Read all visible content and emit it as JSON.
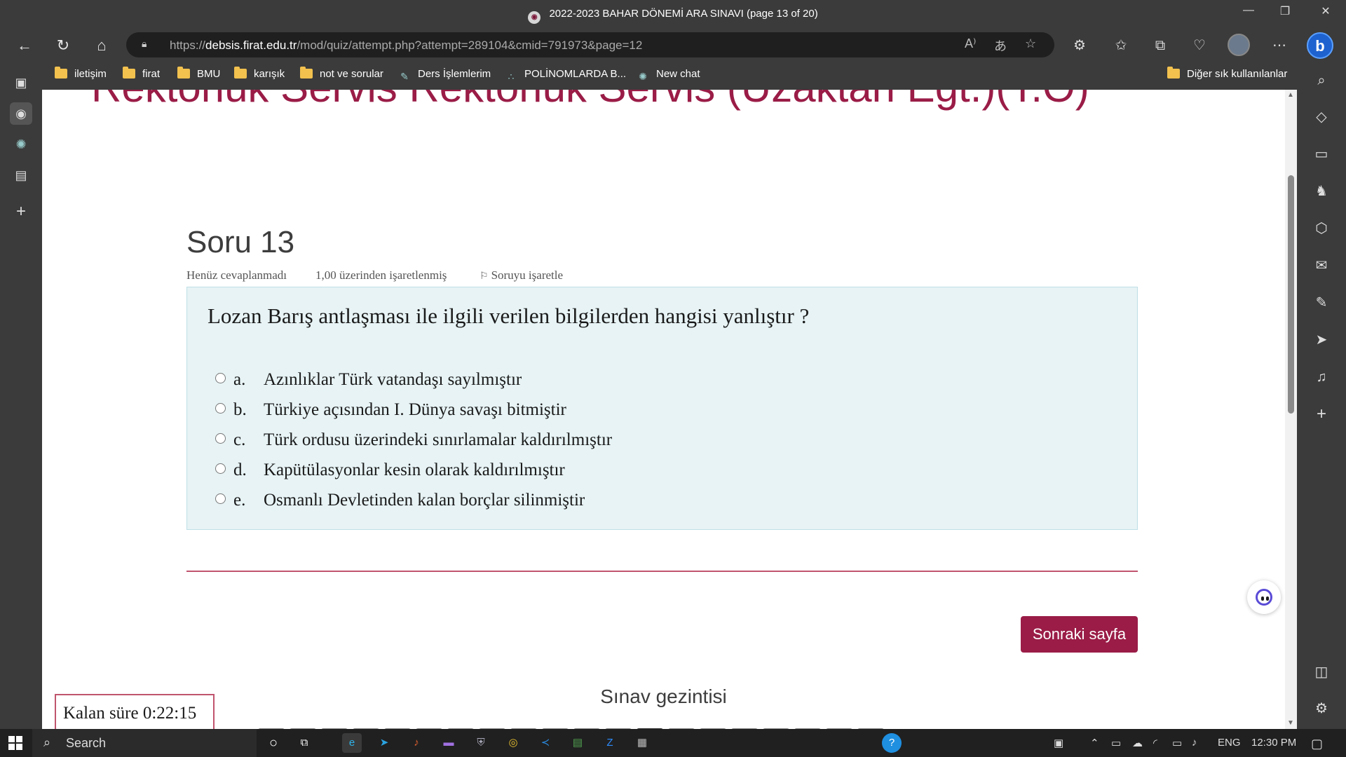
{
  "window": {
    "title": "2022-2023 BAHAR DÖNEMİ ARA SINAVI (page 13 of 20)",
    "controls": [
      "—",
      "❐",
      "✕"
    ]
  },
  "browser": {
    "url_domain": "debsis.firat.edu.tr",
    "url_prefix": "https://",
    "url_path": "/mod/quiz/attempt.php?attempt=289104&cmid=791973&page=12"
  },
  "bookmarks": [
    {
      "label": "iletişim",
      "type": "folder"
    },
    {
      "label": "firat",
      "type": "folder"
    },
    {
      "label": "BMU",
      "type": "folder"
    },
    {
      "label": "karışık",
      "type": "folder"
    },
    {
      "label": "not ve sorular",
      "type": "folder"
    },
    {
      "label": "Ders İşlemlerim",
      "type": "link"
    },
    {
      "label": "POLİNOMLARDA B...",
      "type": "link"
    },
    {
      "label": "New chat",
      "type": "link"
    },
    {
      "label": "Diğer sık kullanılanlar",
      "type": "folder"
    }
  ],
  "page": {
    "site_heading": "Rektörlük Servis Rektörlük Servis (Uzaktan Egt.)(T.Ö)",
    "question_title": "Soru 13",
    "status": "Henüz cevaplanmadı",
    "grade": "1,00 üzerinden işaretlenmiş",
    "flag_label": "Soruyu işaretle",
    "question_text": "Lozan Barış antlaşması ile ilgili verilen bilgilerden hangisi yanlıştır ?",
    "options": [
      {
        "letter": "a.",
        "text": "Azınlıklar Türk vatandaşı sayılmıştır"
      },
      {
        "letter": "b.",
        "text": "Türkiye açısından I. Dünya savaşı bitmiştir"
      },
      {
        "letter": "c.",
        "text": "Türk ordusu üzerindeki sınırlamalar kaldırılmıştır"
      },
      {
        "letter": "d.",
        "text": "Kapütülasyonlar kesin olarak kaldırılmıştır"
      },
      {
        "letter": "e.",
        "text": "Osmanlı Devletinden kalan borçlar silinmiştir"
      }
    ],
    "next_button": "Sonraki sayfa",
    "quiz_nav_title": "Sınav gezintisi",
    "timer": "Kalan süre 0:22:15"
  },
  "taskbar": {
    "search_label": "Search",
    "language": "ENG",
    "time": "12:30 PM"
  },
  "colors": {
    "brand": "#9a1c47",
    "question_bg": "#e7f3f5",
    "browser_chrome": "#3b3b3b"
  }
}
